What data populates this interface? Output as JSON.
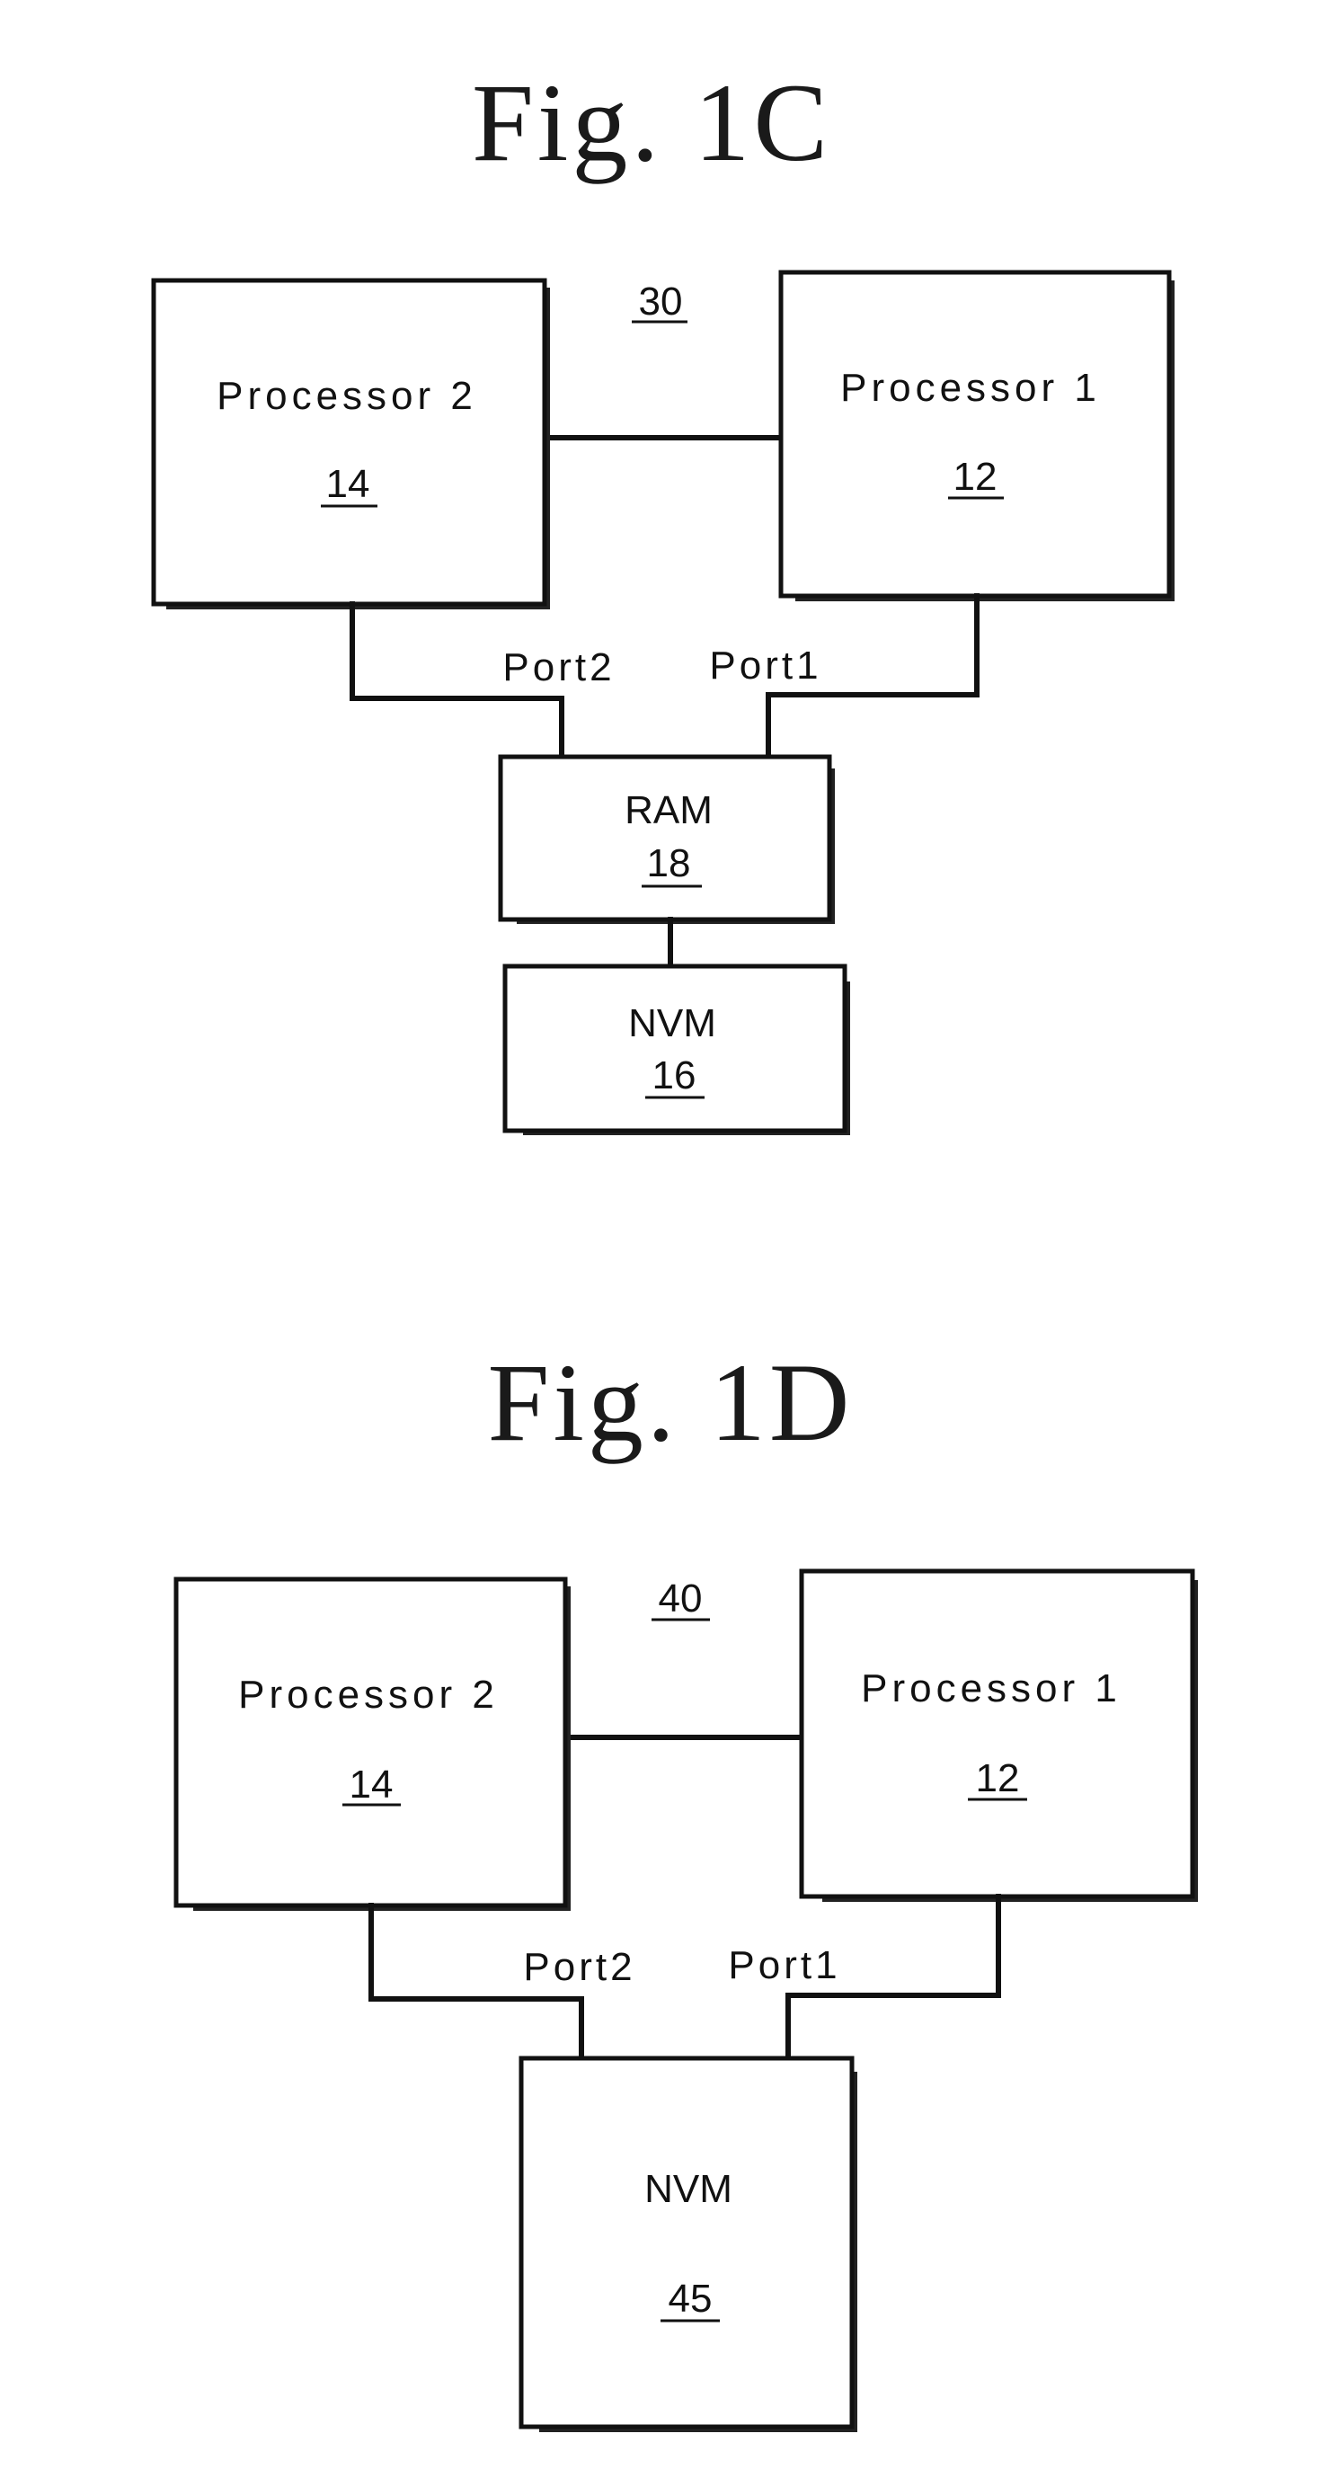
{
  "figures": [
    {
      "title": "Fig.  1C",
      "system_ref": "30",
      "blocks": {
        "processor2": {
          "name": "Processor 2",
          "ref": "14"
        },
        "processor1": {
          "name": "Processor 1",
          "ref": "12"
        },
        "ram": {
          "name": "RAM",
          "ref": "18"
        },
        "nvm": {
          "name": "NVM",
          "ref": "16"
        }
      },
      "ports": {
        "port2": "Port2",
        "port1": "Port1"
      },
      "connections": [
        {
          "from": "Processor 2",
          "to": "Processor 1"
        },
        {
          "from": "Processor 2",
          "to": "RAM",
          "via": "Port2"
        },
        {
          "from": "Processor 1",
          "to": "RAM",
          "via": "Port1"
        },
        {
          "from": "RAM",
          "to": "NVM"
        }
      ]
    },
    {
      "title": "Fig.  1D",
      "system_ref": "40",
      "blocks": {
        "processor2": {
          "name": "Processor 2",
          "ref": "14"
        },
        "processor1": {
          "name": "Processor 1",
          "ref": "12"
        },
        "nvm": {
          "name": "NVM",
          "ref": "45"
        }
      },
      "ports": {
        "port2": "Port2",
        "port1": "Port1"
      },
      "connections": [
        {
          "from": "Processor 2",
          "to": "Processor 1"
        },
        {
          "from": "Processor 2",
          "to": "NVM",
          "via": "Port2"
        },
        {
          "from": "Processor 1",
          "to": "NVM",
          "via": "Port1"
        }
      ]
    }
  ]
}
